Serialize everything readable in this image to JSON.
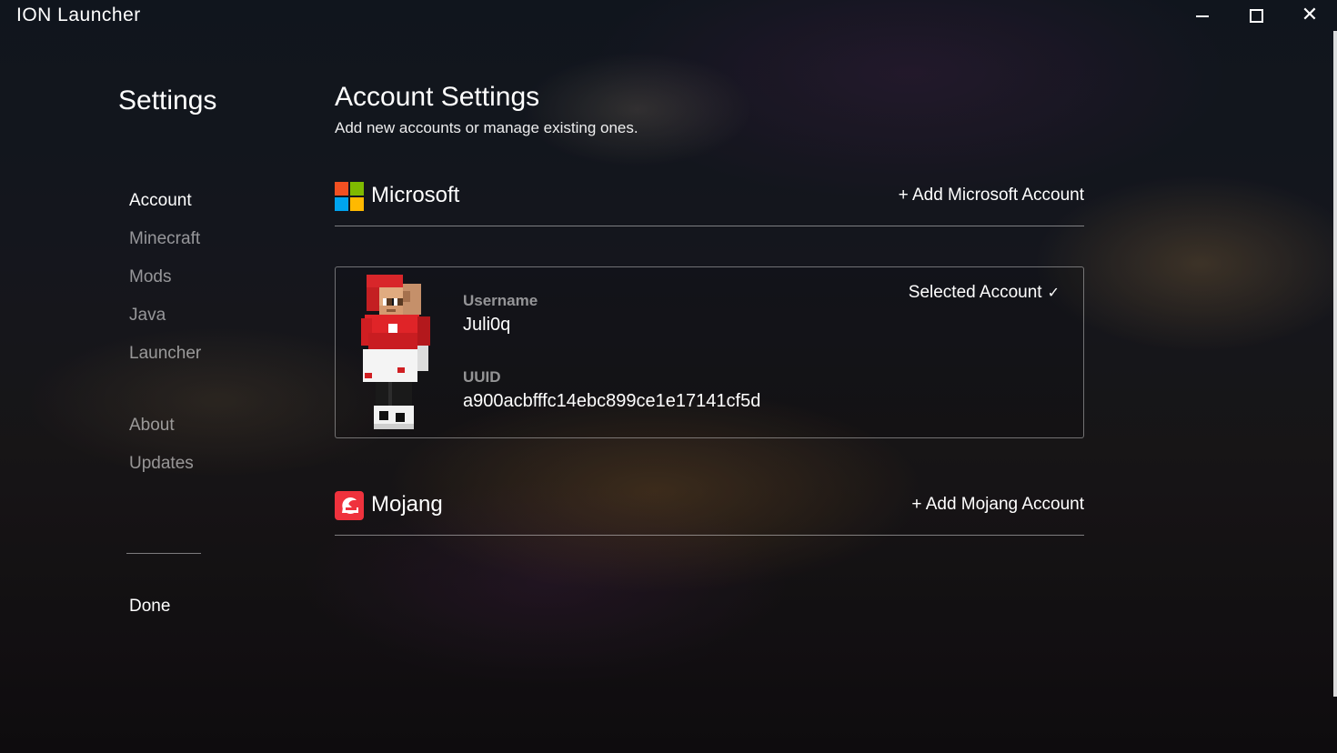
{
  "window": {
    "title": "ION Launcher",
    "controls": [
      "minimize",
      "maximize",
      "close"
    ]
  },
  "sidebar": {
    "title": "Settings",
    "items": [
      {
        "label": "Account",
        "active": true
      },
      {
        "label": "Minecraft",
        "active": false
      },
      {
        "label": "Mods",
        "active": false
      },
      {
        "label": "Java",
        "active": false
      },
      {
        "label": "Launcher",
        "active": false
      },
      {
        "label": "About",
        "active": false
      },
      {
        "label": "Updates",
        "active": false
      }
    ],
    "done_label": "Done"
  },
  "main": {
    "title": "Account Settings",
    "subtitle": "Add new accounts or manage existing ones.",
    "microsoft": {
      "name": "Microsoft",
      "add_label": "+ Add Microsoft Account",
      "logo_colors": [
        "#f25022",
        "#7fba00",
        "#00a4ef",
        "#ffb900"
      ],
      "accounts": [
        {
          "username_label": "Username",
          "username": "Juli0q",
          "uuid_label": "UUID",
          "uuid": "a900acbfffc14ebc899ce1e17141cf5d",
          "selected_label": "Selected Account",
          "selected": true,
          "avatar_icon": "player-skin-icon"
        }
      ]
    },
    "mojang": {
      "name": "Mojang",
      "add_label": "+ Add Mojang Account",
      "logo_color": "#ef323d"
    }
  }
}
